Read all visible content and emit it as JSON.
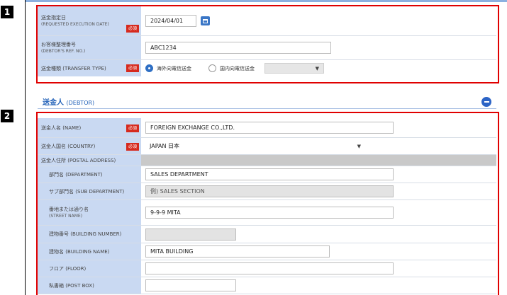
{
  "callouts": [
    "1",
    "2"
  ],
  "remittance": {
    "requested_date": {
      "label": "送金指定日",
      "sub": "(REQUESTED EXECUTION DATE)",
      "required": "必須",
      "value": "2024/04/01"
    },
    "ref_no": {
      "label": "お客様整理番号",
      "sub": "(DEBTOR'S REF. NO.)",
      "value": "ABC1234"
    },
    "transfer_type": {
      "label": "送金種類 (TRANSFER TYPE)",
      "required": "必須",
      "options": [
        "海外向電信送金",
        "国内向電信送金"
      ],
      "selected": 0
    }
  },
  "debtor_section": {
    "title": "送金人",
    "title_en": "(DEBTOR)"
  },
  "debtor": {
    "name": {
      "label": "送金人名 (NAME)",
      "required": "必須",
      "value": "FOREIGN EXCHANGE CO.,LTD."
    },
    "country": {
      "label": "送金人国名 (COUNTRY)",
      "required": "必須",
      "value": "JAPAN 日本"
    },
    "address": {
      "label": "送金人住所 (POSTAL ADDRESS)"
    },
    "department": {
      "label": "部門名 (DEPARTMENT)",
      "value": "SALES DEPARTMENT"
    },
    "sub_department": {
      "label": "サブ部門名 (SUB DEPARTMENT)",
      "placeholder": "例) SALES SECTION"
    },
    "street": {
      "label": "番地または通り名",
      "sub": "(STREET NAME)",
      "value": "9-9-9 MITA"
    },
    "building_number": {
      "label": "建物番号 (BUILDING NUMBER)",
      "value": ""
    },
    "building_name": {
      "label": "建物名 (BUILDING NAME)",
      "value": "MITA BUILDING"
    },
    "floor": {
      "label": "フロア (FLOOR)",
      "value": ""
    },
    "post_box": {
      "label": "私書箱 (POST BOX)",
      "value": ""
    }
  }
}
